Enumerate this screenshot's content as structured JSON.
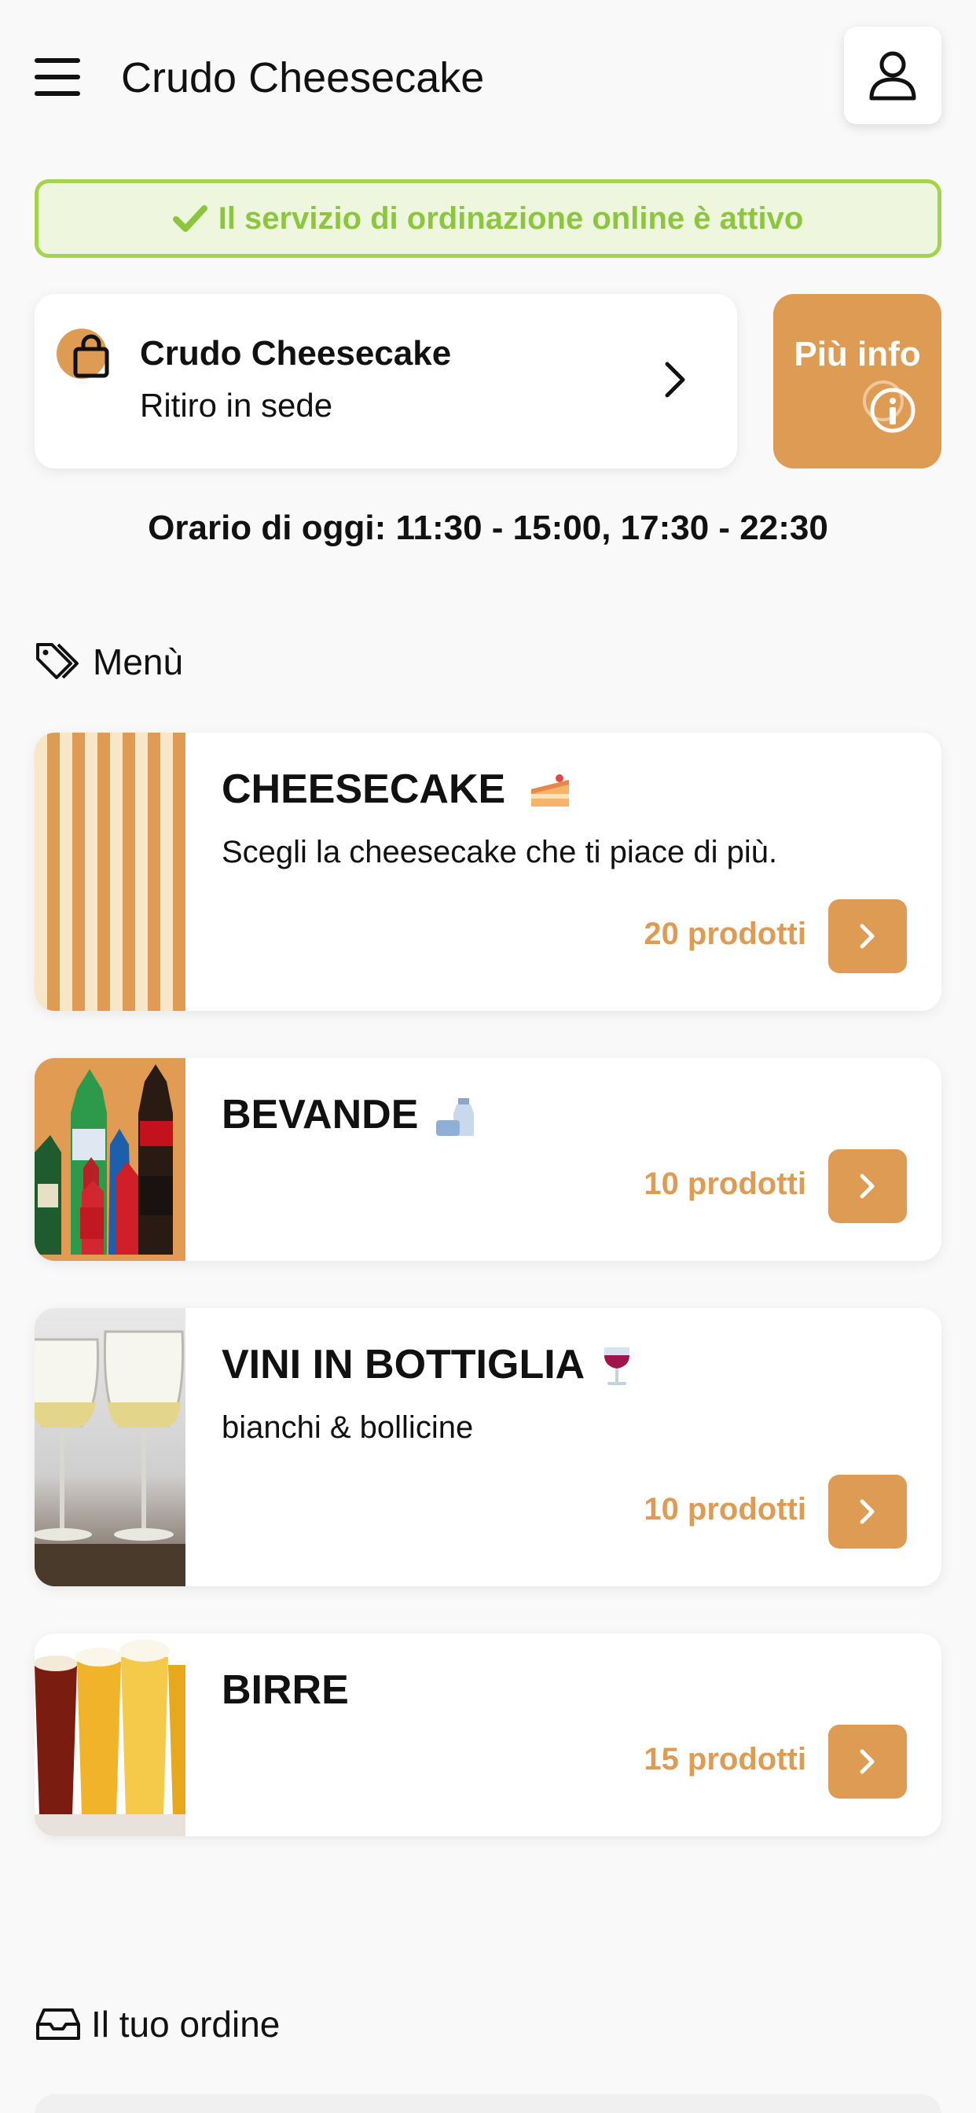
{
  "header": {
    "title": "Crudo Cheesecake",
    "menu_icon": "hamburger-icon",
    "profile_icon": "user-icon"
  },
  "status": {
    "text": "Il servizio di ordinazione online è attivo",
    "icon": "check-icon",
    "color": "#8cc63f"
  },
  "store": {
    "name": "Crudo Cheesecake",
    "mode": "Ritiro in sede",
    "icon": "shopping-bag-icon"
  },
  "info_button": {
    "label": "Più info",
    "icon": "info-circle-icon"
  },
  "hours": "Orario di oggi: 11:30 - 15:00, 17:30 - 22:30",
  "menu_section": {
    "label": "Menù",
    "icon": "tag-icon"
  },
  "categories": [
    {
      "title": "CHEESECAKE",
      "emoji": "cake-slice",
      "description": "Scegli la cheesecake che ti piace di più.",
      "count": "20 prodotti",
      "thumb": "orange-stripes"
    },
    {
      "title": "BEVANDE",
      "emoji": "milk-bottle",
      "description": "",
      "count": "10 prodotti",
      "thumb": "soft-drink-bottles"
    },
    {
      "title": "VINI IN BOTTIGLIA",
      "emoji": "wine-glass",
      "description": "bianchi & bollicine",
      "count": "10 prodotti",
      "thumb": "white-wine-glasses"
    },
    {
      "title": "BIRRE",
      "emoji": "",
      "description": "",
      "count": "15 prodotti",
      "thumb": "beer-glasses"
    }
  ],
  "order_section": {
    "label": "Il tuo ordine",
    "icon": "inbox-icon"
  },
  "colors": {
    "accent": "#dd9b53",
    "success": "#8cc63f",
    "success_bg": "#eef7dd"
  }
}
